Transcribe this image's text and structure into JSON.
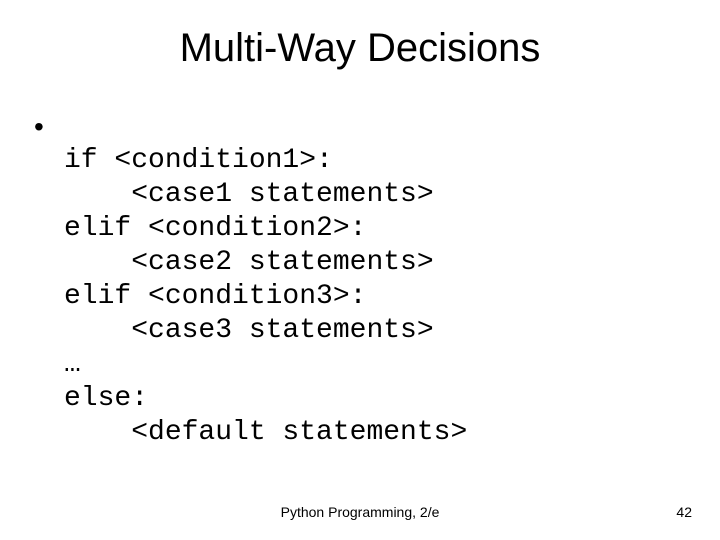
{
  "title": "Multi-Way Decisions",
  "bullet": "•",
  "code_lines": [
    "if <condition1>:",
    "    <case1 statements>",
    "elif <condition2>:",
    "    <case2 statements>",
    "elif <condition3>:",
    "    <case3 statements>",
    "…",
    "else:",
    "    <default statements>"
  ],
  "footer_center": "Python Programming, 2/e",
  "footer_page": "42"
}
